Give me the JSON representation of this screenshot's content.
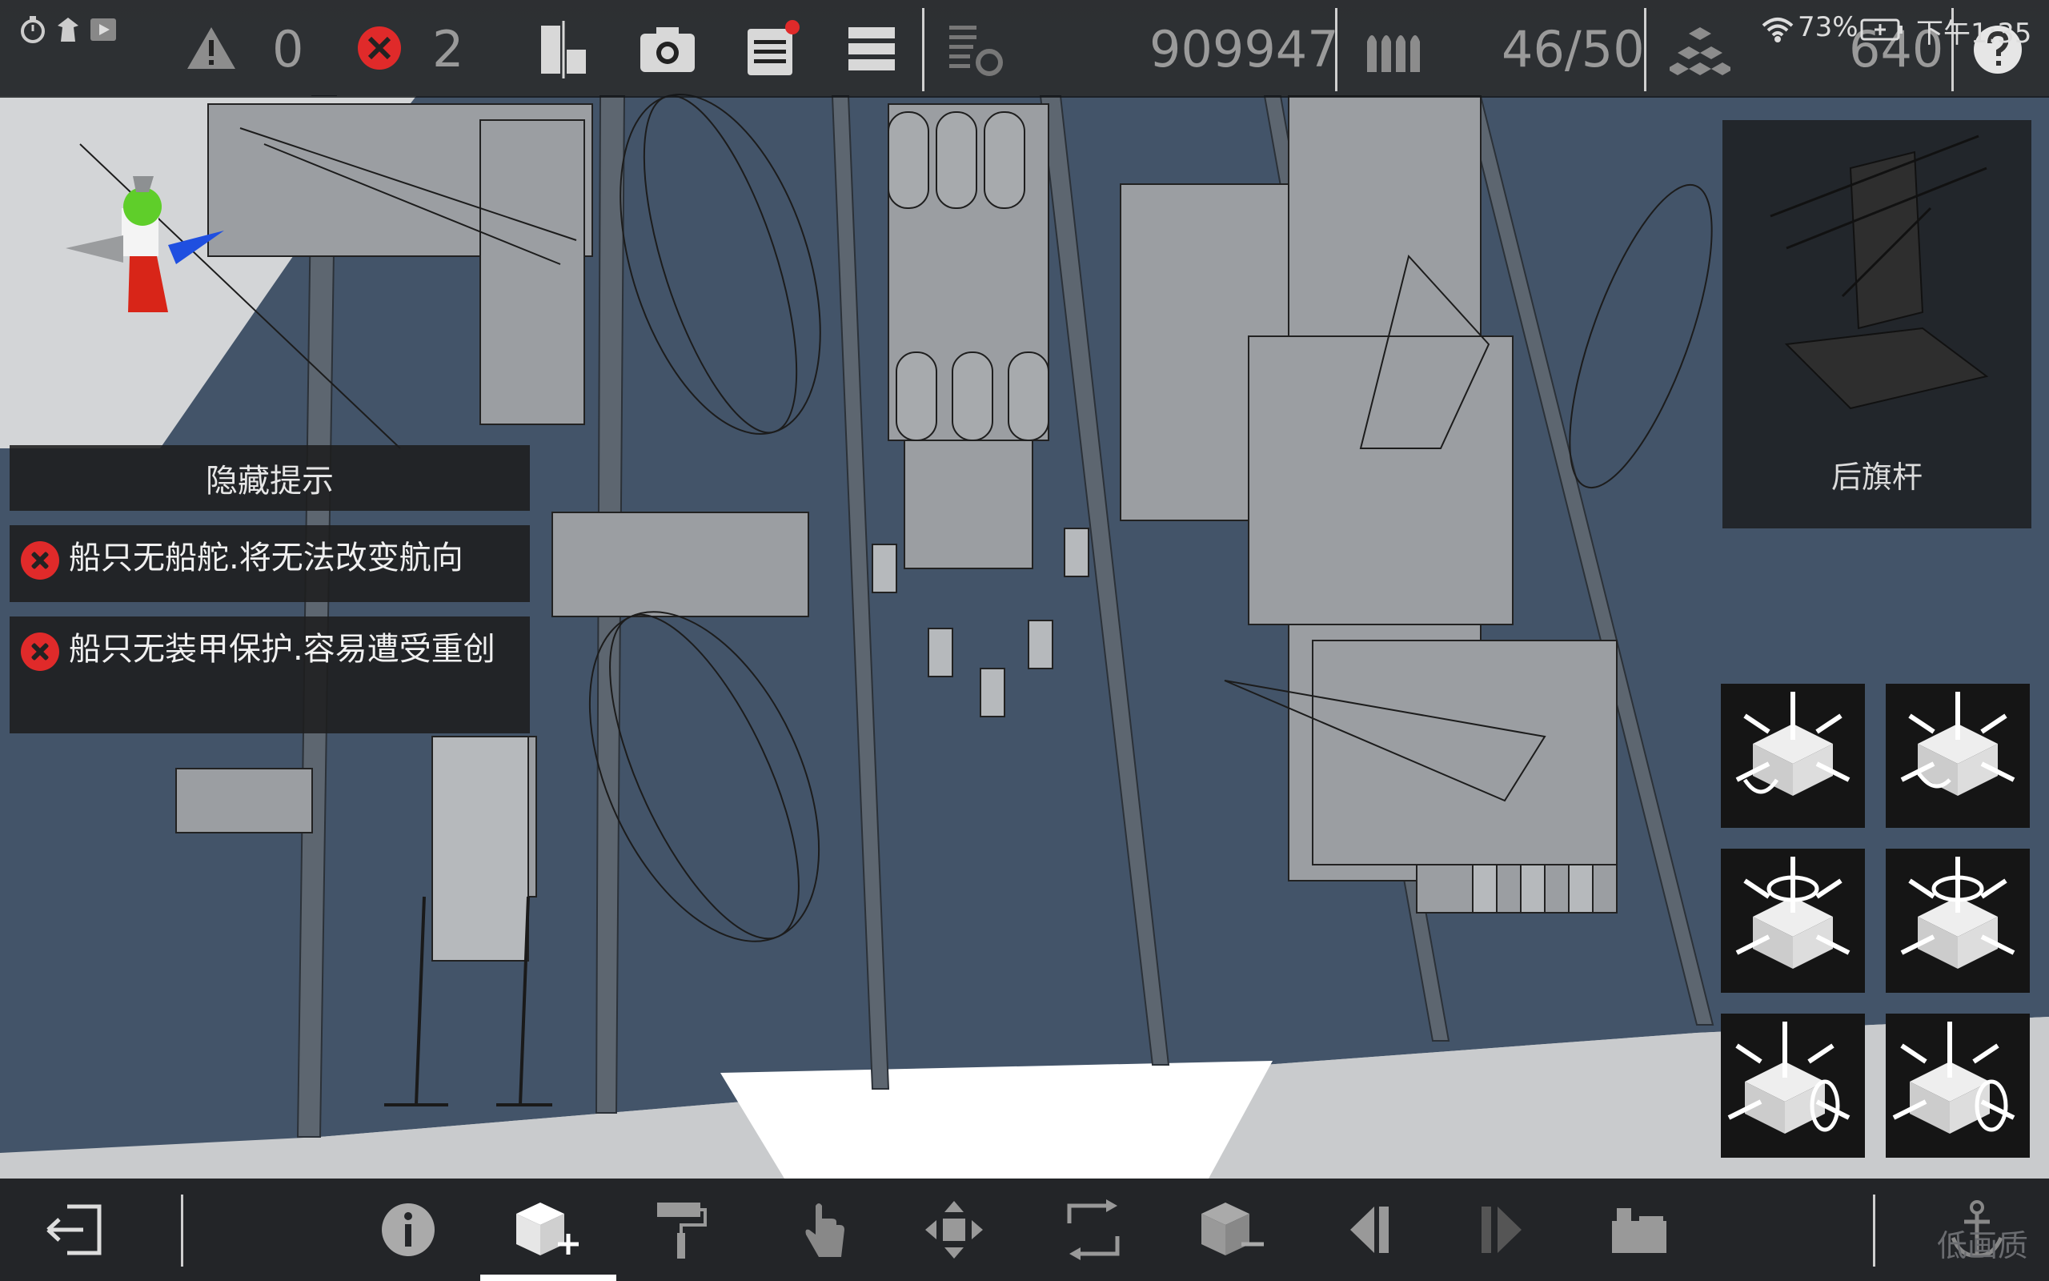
{
  "status_bar": {
    "wifi_icon": "wifi-icon",
    "battery_percent": "73%",
    "battery_icon": "battery-charging-icon",
    "time": "下午1:35"
  },
  "top_toolbar": {
    "warning_count": "0",
    "error_count": "2",
    "total_value": "909947",
    "ammo_count": "46/50",
    "block_count": "640"
  },
  "hints": {
    "hide_label": "隐藏提示",
    "warnings": [
      {
        "text": "船只无船舵.将无法改变航向",
        "icon": "error-icon"
      },
      {
        "text": "船只无装甲保护.容易遭受重创",
        "icon": "error-icon"
      }
    ]
  },
  "selected_part": {
    "name": "后旗杆"
  },
  "colors": {
    "deck": "#435469",
    "error": "#e02a2a",
    "toolbar_bg": "#232528",
    "active_tab": "#ffffff"
  },
  "bottom_toolbar": {
    "active_tool": "add-part",
    "watermark": "低画质"
  }
}
